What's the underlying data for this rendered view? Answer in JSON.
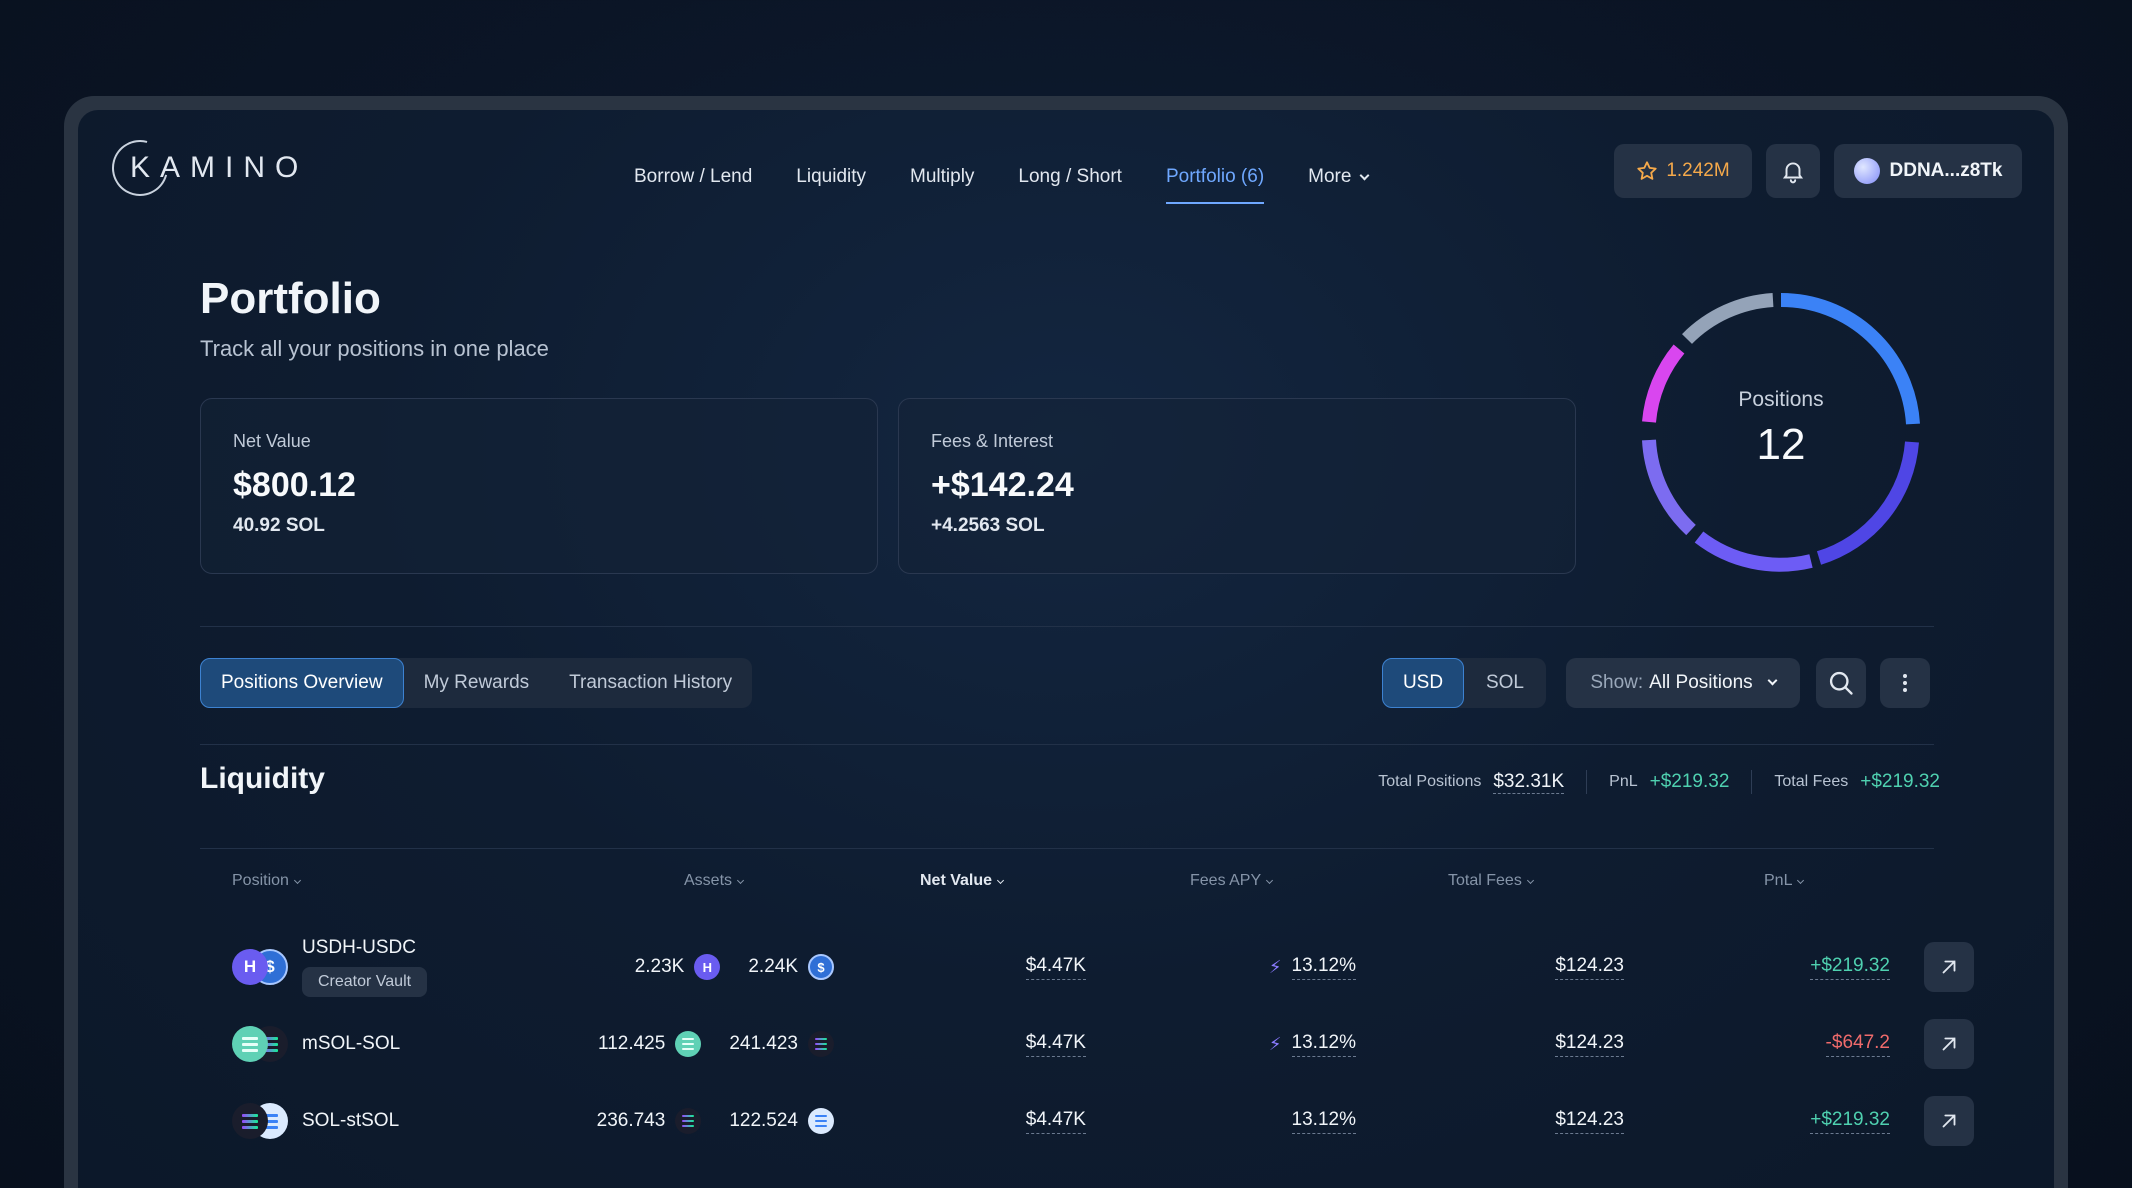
{
  "brand": {
    "name": "KAMINO"
  },
  "nav": {
    "items": [
      {
        "label": "Borrow / Lend"
      },
      {
        "label": "Liquidity"
      },
      {
        "label": "Multiply"
      },
      {
        "label": "Long / Short"
      },
      {
        "label": "Portfolio (6)"
      },
      {
        "label": "More"
      }
    ],
    "active_index": 4
  },
  "header": {
    "points": "1.242M",
    "wallet": "DDNA...z8Tk"
  },
  "page": {
    "title": "Portfolio",
    "subtitle": "Track all your positions in one place"
  },
  "cards": [
    {
      "label": "Net Value",
      "value": "$800.12",
      "sub": "40.92 SOL"
    },
    {
      "label": "Fees & Interest",
      "value": "+$142.24",
      "sub": "+4.2563 SOL"
    }
  ],
  "positions_ring": {
    "label": "Positions",
    "value": "12",
    "colors": [
      "#3b82f6",
      "#4f46e5",
      "#6d5cf5",
      "#7c6cf0",
      "#d946ef",
      "#94a3b8"
    ]
  },
  "tabs": [
    {
      "label": "Positions Overview",
      "active": true
    },
    {
      "label": "My Rewards",
      "active": false
    },
    {
      "label": "Transaction History",
      "active": false
    }
  ],
  "currency_toggle": {
    "options": [
      "USD",
      "SOL"
    ],
    "selected": "USD"
  },
  "show_filter": {
    "prefix": "Show:",
    "value": "All Positions"
  },
  "liquidity": {
    "title": "Liquidity",
    "stats": {
      "total_positions_label": "Total Positions",
      "total_positions_value": "$32.31K",
      "pnl_label": "PnL",
      "pnl_value": "+$219.32",
      "total_fees_label": "Total Fees",
      "total_fees_value": "+$219.32"
    },
    "columns": [
      "Position",
      "Assets",
      "Net Value",
      "Fees APY",
      "Total Fees",
      "PnL"
    ],
    "rows": [
      {
        "name": "USDH-USDC",
        "tag": "Creator Vault",
        "asset_a": "2.23K",
        "asset_b": "2.24K",
        "net_value": "$4.47K",
        "fees_apy": "13.12%",
        "boosted": true,
        "total_fees": "$124.23",
        "pnl": "+$219.32",
        "pnl_positive": true
      },
      {
        "name": "mSOL-SOL",
        "tag": "",
        "asset_a": "112.425",
        "asset_b": "241.423",
        "net_value": "$4.47K",
        "fees_apy": "13.12%",
        "boosted": true,
        "total_fees": "$124.23",
        "pnl": "-$647.2",
        "pnl_positive": false
      },
      {
        "name": "SOL-stSOL",
        "tag": "",
        "asset_a": "236.743",
        "asset_b": "122.524",
        "net_value": "$4.47K",
        "fees_apy": "13.12%",
        "boosted": false,
        "total_fees": "$124.23",
        "pnl": "+$219.32",
        "pnl_positive": true
      }
    ]
  },
  "colors": {
    "accent": "#6fa8ff",
    "positive": "#4fd1b0",
    "negative": "#f06b6b",
    "points": "#f5a94a"
  },
  "icons": {
    "points": "star-icon",
    "notifications": "bell-icon",
    "search": "search-icon",
    "more": "vertical-dots-icon",
    "open": "arrow-up-right-icon",
    "boost": "lightning-icon"
  }
}
